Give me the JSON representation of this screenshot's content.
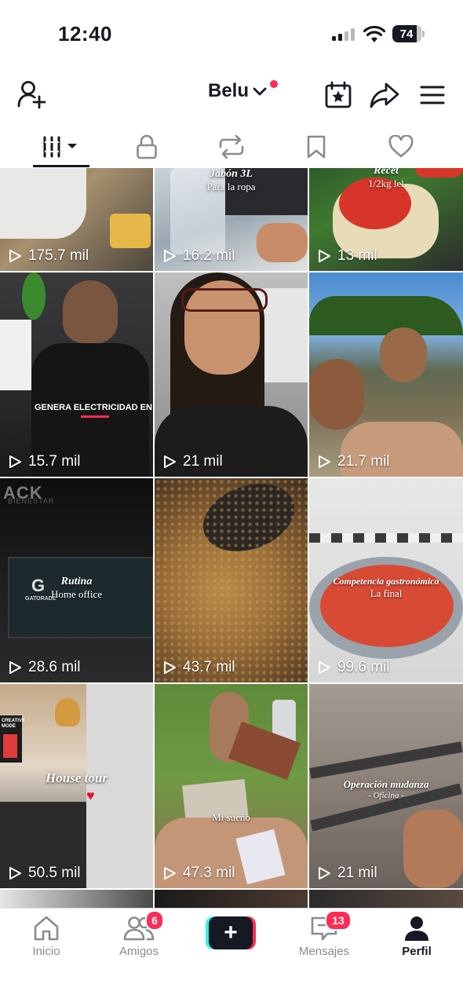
{
  "status_bar": {
    "time": "12:40",
    "battery": "74"
  },
  "header": {
    "username": "Belu"
  },
  "tabs": [
    {
      "name": "videos",
      "icon": "grid-icon",
      "active": true
    },
    {
      "name": "private",
      "icon": "lock-icon"
    },
    {
      "name": "reposts",
      "icon": "repost-icon"
    },
    {
      "name": "favorites",
      "icon": "bookmark-icon"
    },
    {
      "name": "liked",
      "icon": "heart-icon"
    }
  ],
  "videos": [
    {
      "views": "175.7 mil"
    },
    {
      "views": "16.2 mil",
      "caption_line1": "Jabón 3L",
      "caption_line2": "Para la ropa"
    },
    {
      "views": "13 mil",
      "caption_line1": "Recet",
      "caption_line2": "1/2kg lel"
    },
    {
      "views": "15.7 mil",
      "caption_line1": "GENERA ELECTRICIDAD EN"
    },
    {
      "views": "21 mil"
    },
    {
      "views": "21.7 mil"
    },
    {
      "views": "28.6 mil",
      "caption_line1": "Rutina",
      "caption_line2": "Home office",
      "logo_text": "GATORADE",
      "sign_text": "ACK",
      "sign_sub": "BIENESTAR"
    },
    {
      "views": "43.7 mil"
    },
    {
      "views": "99.6 mil",
      "caption_line1": "Competencia gastronómica",
      "caption_line2": "La final"
    },
    {
      "views": "50.5 mil",
      "caption_line1": "House tour",
      "poster_text": "CREATIVE MODE"
    },
    {
      "views": "47.3 mil",
      "caption_line1": "Mi sueño"
    },
    {
      "views": "21 mil",
      "caption_line1": "Operación mudanza",
      "caption_line2": "- Oficina -"
    }
  ],
  "bottom_nav": {
    "home": "Inicio",
    "friends": "Amigos",
    "friends_badge": "6",
    "create": "+",
    "messages": "Mensajes",
    "messages_badge": "13",
    "profile": "Perfil"
  },
  "colors": {
    "accent": "#fe2c55",
    "cyan": "#25f4ee",
    "text": "#161823",
    "muted": "#8a8b91"
  }
}
